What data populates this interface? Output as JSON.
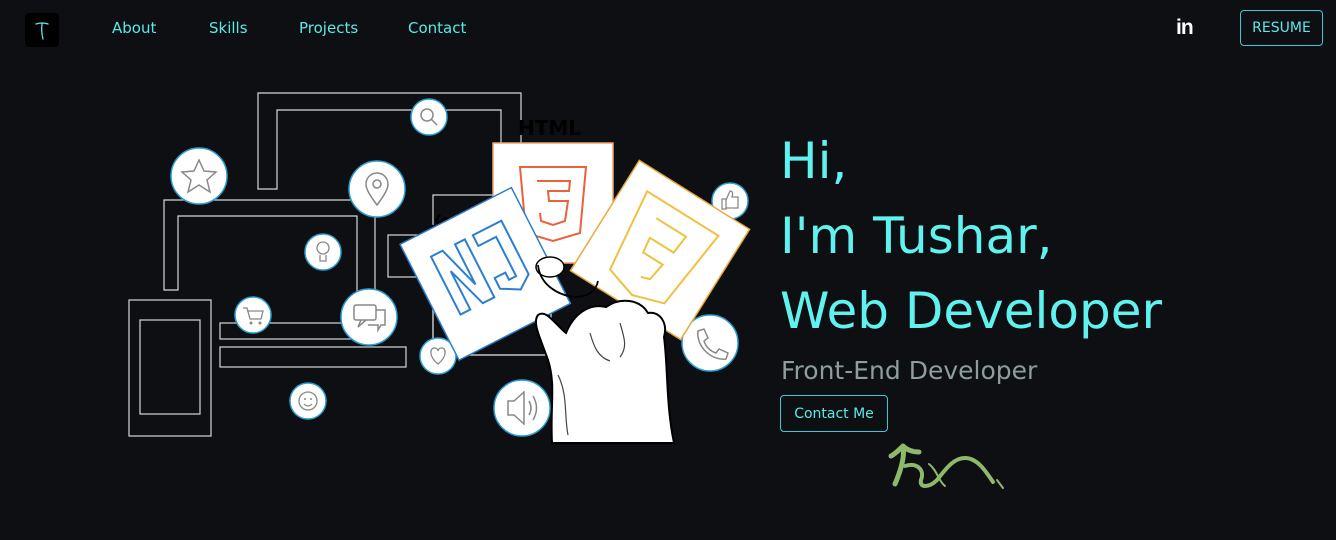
{
  "nav": {
    "logo_letter": "T",
    "links": [
      {
        "label": "About"
      },
      {
        "label": "Skills"
      },
      {
        "label": "Projects"
      },
      {
        "label": "Contact"
      }
    ],
    "linkedin_label": "in",
    "resume_label": "RESUME"
  },
  "hero": {
    "line1": "Hi,",
    "line2": "I'm Tushar,",
    "line3": "Web Developer",
    "subtitle": "Front-End Developer",
    "contact_label": "Contact Me"
  },
  "illustration": {
    "html_label": "HTML",
    "js_label": "JS",
    "css_label": "CSS"
  },
  "colors": {
    "accent": "#5ee9e9",
    "background": "#0d0f12",
    "subtitle": "#8f9e9a",
    "arrow": "#8fb96a"
  }
}
